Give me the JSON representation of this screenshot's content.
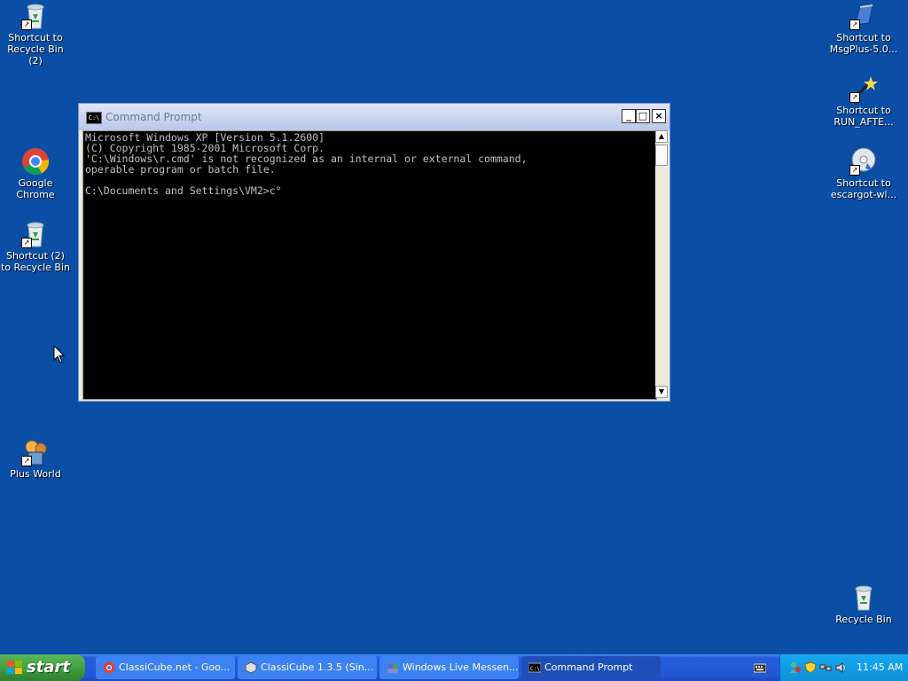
{
  "desktop": {
    "icons": [
      {
        "label": "Shortcut to Recycle Bin (2)"
      },
      {
        "label": "Google Chrome"
      },
      {
        "label": "Shortcut (2) to Recycle Bin"
      },
      {
        "label": "Plus World"
      },
      {
        "label": "Shortcut to MsgPlus-5.0..."
      },
      {
        "label": "Shortcut to RUN_AFTE..."
      },
      {
        "label": "Shortcut to escargot-wl..."
      },
      {
        "label": "Recycle Bin"
      }
    ]
  },
  "cmd_window": {
    "title": "Command Prompt",
    "icon_text": "C:\\",
    "lines": "Microsoft Windows XP [Version 5.1.2600]\n(C) Copyright 1985-2001 Microsoft Corp.\n'C:\\Windows\\r.cmd' is not recognized as an internal or external command,\noperable program or batch file.\n\nC:\\Documents and Settings\\VM2>c°",
    "minimize_label": "_",
    "maximize_label": "□",
    "close_label": "×",
    "scroll_up": "▲",
    "scroll_down": "▼"
  },
  "taskbar": {
    "start_label": "start",
    "tasks": [
      {
        "label": "ClassiCube.net - Goo..."
      },
      {
        "label": "ClassiCube 1.3.5 (Sin..."
      },
      {
        "label": "Windows Live Messen..."
      },
      {
        "label": "Command Prompt"
      }
    ],
    "clock": "11:45 AM"
  }
}
